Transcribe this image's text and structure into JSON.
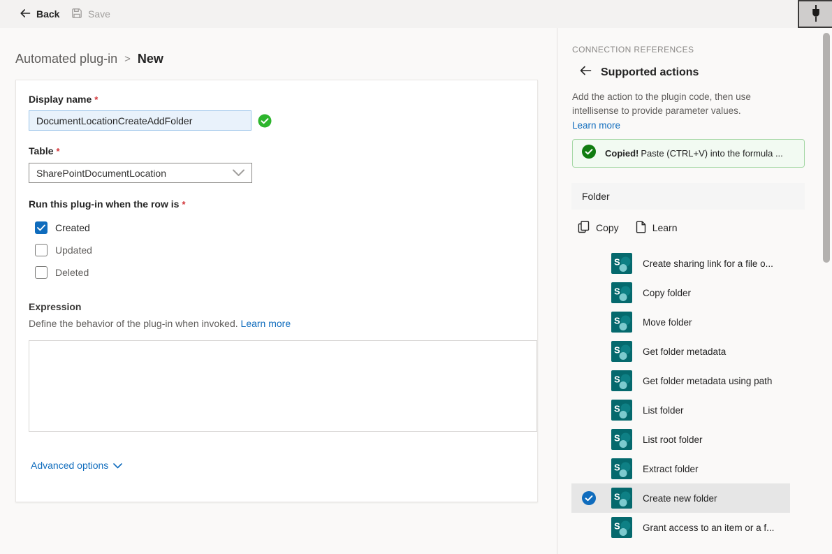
{
  "toolbar": {
    "back_label": "Back",
    "save_label": "Save"
  },
  "breadcrumb": {
    "parent": "Automated plug-in",
    "separator": ">",
    "current": "New"
  },
  "form": {
    "display_name": {
      "label": "Display name",
      "required_marker": "*",
      "value": "DocumentLocationCreateAddFolder"
    },
    "table": {
      "label": "Table",
      "required_marker": "*",
      "value": "SharePointDocumentLocation"
    },
    "trigger": {
      "label": "Run this plug-in when the row is",
      "required_marker": "*",
      "options": [
        {
          "label": "Created",
          "checked": true
        },
        {
          "label": "Updated",
          "checked": false
        },
        {
          "label": "Deleted",
          "checked": false
        }
      ]
    },
    "expression": {
      "label": "Expression",
      "description": "Define the behavior of the plug-in when invoked.",
      "learn_more": "Learn more",
      "value": ""
    },
    "advanced_options_label": "Advanced options"
  },
  "panel": {
    "eyebrow": "CONNECTION REFERENCES",
    "title": "Supported actions",
    "description": "Add the action to the plugin code, then use intellisense to provide parameter values.",
    "learn_more": "Learn more",
    "toast": {
      "bold": "Copied!",
      "text": "Paste (CTRL+V) into the formula ..."
    },
    "group_header": "Folder",
    "copy_button": "Copy",
    "learn_button": "Learn",
    "actions": [
      {
        "label": "Create sharing link for a file o...",
        "selected": false
      },
      {
        "label": "Copy folder",
        "selected": false
      },
      {
        "label": "Move folder",
        "selected": false
      },
      {
        "label": "Get folder metadata",
        "selected": false
      },
      {
        "label": "Get folder metadata using path",
        "selected": false
      },
      {
        "label": "List folder",
        "selected": false
      },
      {
        "label": "List root folder",
        "selected": false
      },
      {
        "label": "Extract folder",
        "selected": false
      },
      {
        "label": "Create new folder",
        "selected": true
      },
      {
        "label": "Grant access to an item or a f...",
        "selected": false
      }
    ]
  },
  "colors": {
    "accent_blue": "#0f6cbd",
    "success_green": "#2db52d",
    "toast_green_dark": "#107c10",
    "toast_green_bg": "#f2faf2",
    "toast_green_border": "#a6d8a6",
    "sharepoint_teal": "#036c70",
    "required_red": "#d13438",
    "selected_row_bg": "#e6e6e6"
  }
}
